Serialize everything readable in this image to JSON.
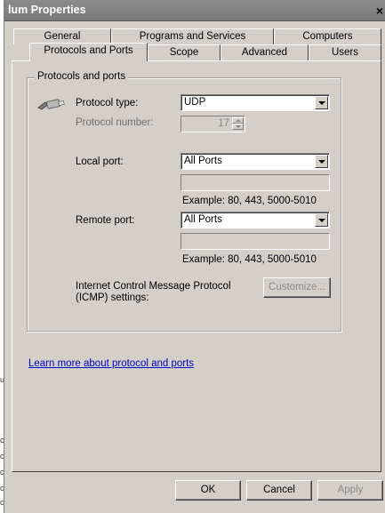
{
  "window": {
    "title": "lum Properties",
    "close_glyph": "×"
  },
  "background": {
    "fragments": [
      "ul",
      "ce",
      "ce",
      "ce",
      "ce",
      "ce"
    ]
  },
  "tabs": {
    "row1": [
      "General",
      "Programs and Services",
      "Computers"
    ],
    "row2": [
      "Protocols and Ports",
      "Scope",
      "Advanced",
      "Users"
    ],
    "active": "Protocols and Ports"
  },
  "group": {
    "title": "Protocols and ports"
  },
  "protocol_type": {
    "label": "Protocol type:",
    "value": "UDP",
    "icon": "network-cable-icon"
  },
  "protocol_number": {
    "label": "Protocol number:",
    "value": "17"
  },
  "local_port": {
    "label": "Local port:",
    "value": "All Ports",
    "example": "Example: 80, 443, 5000-5010"
  },
  "remote_port": {
    "label": "Remote port:",
    "value": "All Ports",
    "example": "Example: 80, 443, 5000-5010"
  },
  "icmp": {
    "label_line1": "Internet Control Message Protocol",
    "label_line2": "(ICMP) settings:",
    "button": "Customize..."
  },
  "learn_more": {
    "link": "Learn more about protocol and ports"
  },
  "footer": {
    "ok": "OK",
    "cancel": "Cancel",
    "apply": "Apply"
  }
}
